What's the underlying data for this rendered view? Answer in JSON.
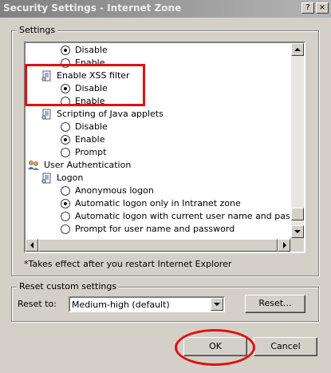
{
  "window": {
    "title": "Security Settings - Internet Zone",
    "help_label": "?",
    "close_label": "×"
  },
  "settings_group": {
    "label": "Settings"
  },
  "settings_list": {
    "items": [
      {
        "kind": "radio",
        "label": "Disable",
        "checked": true
      },
      {
        "kind": "radio",
        "label": "Enable",
        "checked": false
      },
      {
        "kind": "category",
        "label": "Enable XSS filter",
        "icon": "settings-page-icon"
      },
      {
        "kind": "radio",
        "label": "Disable",
        "checked": true
      },
      {
        "kind": "radio",
        "label": "Enable",
        "checked": false
      },
      {
        "kind": "category",
        "label": "Scripting of Java applets",
        "icon": "settings-page-icon"
      },
      {
        "kind": "radio",
        "label": "Disable",
        "checked": false
      },
      {
        "kind": "radio",
        "label": "Enable",
        "checked": true
      },
      {
        "kind": "radio",
        "label": "Prompt",
        "checked": false
      },
      {
        "kind": "category",
        "label": "User Authentication",
        "icon": "users-icon"
      },
      {
        "kind": "category",
        "label": "Logon",
        "icon": "settings-page-icon"
      },
      {
        "kind": "radio",
        "label": "Anonymous logon",
        "checked": false
      },
      {
        "kind": "radio",
        "label": "Automatic logon only in Intranet zone",
        "checked": true
      },
      {
        "kind": "radio",
        "label": "Automatic logon with current user name and password",
        "checked": false
      },
      {
        "kind": "radio",
        "label": "Prompt for user name and password",
        "checked": false
      }
    ],
    "vertical_scroll_fraction": 0.97
  },
  "restart_note": "*Takes effect after you restart Internet Explorer",
  "reset_group": {
    "label": "Reset custom settings",
    "reset_to_label": "Reset to:",
    "selected_level": "Medium-high (default)",
    "reset_button_label": "Reset..."
  },
  "footer": {
    "ok_label": "OK",
    "cancel_label": "Cancel"
  },
  "colors": {
    "dialog_background": "#d4d0c8",
    "annotation_red": "#e01010",
    "inactive_titlebar": "#808080"
  }
}
